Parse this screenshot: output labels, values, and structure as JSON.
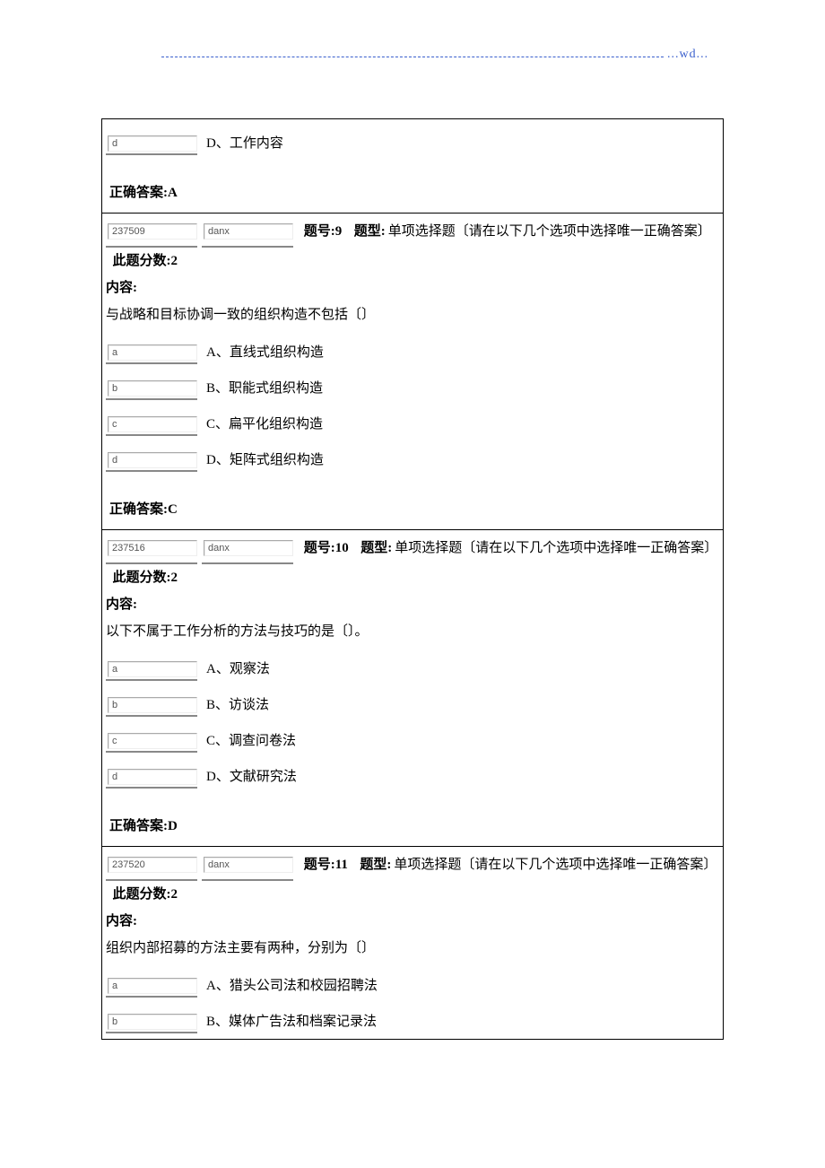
{
  "header": {
    "wd": "...wd..."
  },
  "q8_tail": {
    "opt_d_code": "d",
    "opt_d_text": "D、工作内容",
    "answer": "正确答案:A"
  },
  "q9": {
    "id": "237509",
    "type_code": "danx",
    "num_label": "题号:9",
    "type_label": "题型:",
    "type_text": "单项选择题〔请在以下几个选项中选择唯一正确答案〕",
    "score_label": "此题分数:2",
    "content_label": "内容:",
    "content_text": "与战略和目标协调一致的组织构造不包括〔〕",
    "opts": [
      {
        "code": "a",
        "text": "A、直线式组织构造"
      },
      {
        "code": "b",
        "text": "B、职能式组织构造"
      },
      {
        "code": "c",
        "text": "C、扁平化组织构造"
      },
      {
        "code": "d",
        "text": "D、矩阵式组织构造"
      }
    ],
    "answer": "正确答案:C"
  },
  "q10": {
    "id": "237516",
    "type_code": "danx",
    "num_label": "题号:10",
    "type_label": "题型:",
    "type_text": "单项选择题〔请在以下几个选项中选择唯一正确答案〕",
    "score_label": "此题分数:2",
    "content_label": "内容:",
    "content_text": "以下不属于工作分析的方法与技巧的是〔〕。",
    "opts": [
      {
        "code": "a",
        "text": "A、观察法"
      },
      {
        "code": "b",
        "text": "B、访谈法"
      },
      {
        "code": "c",
        "text": "C、调查问卷法"
      },
      {
        "code": "d",
        "text": "D、文献研究法"
      }
    ],
    "answer": "正确答案:D"
  },
  "q11": {
    "id": "237520",
    "type_code": "danx",
    "num_label": "题号:11",
    "type_label": "题型:",
    "type_text": "单项选择题〔请在以下几个选项中选择唯一正确答案〕",
    "score_label": "此题分数:2",
    "content_label": "内容:",
    "content_text": "组织内部招募的方法主要有两种，分别为〔〕",
    "opts": [
      {
        "code": "a",
        "text": "A、猎头公司法和校园招聘法"
      },
      {
        "code": "b",
        "text": "B、媒体广告法和档案记录法"
      }
    ]
  }
}
